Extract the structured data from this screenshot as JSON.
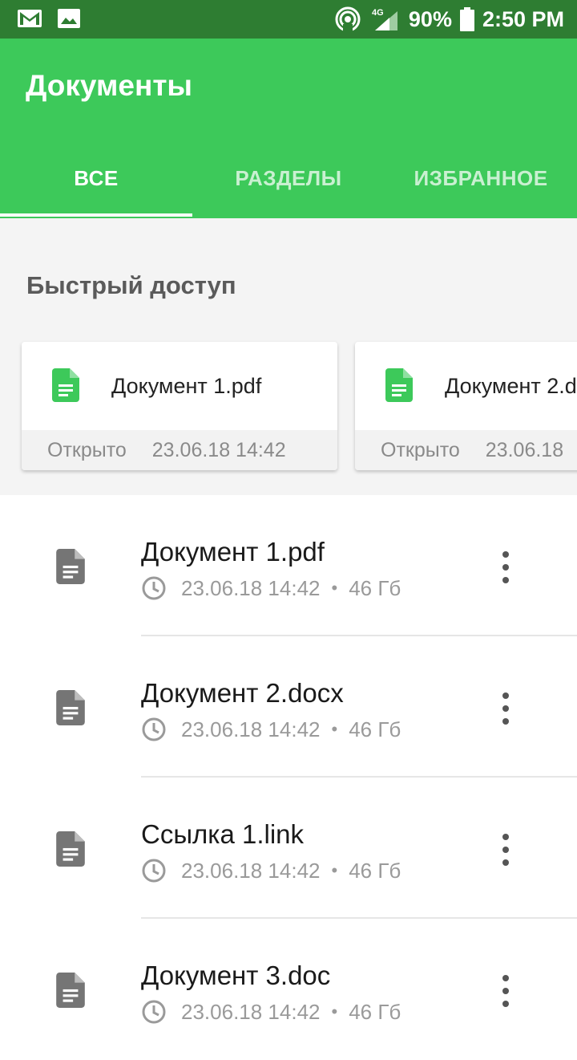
{
  "status_bar": {
    "left_icons": [
      "gmail-icon",
      "image-icon"
    ],
    "network": "4G",
    "battery": "90%",
    "time": "2:50 PM"
  },
  "app": {
    "title": "Документы",
    "accent_color": "#3dc95a",
    "status_bar_color": "#2e7d32"
  },
  "tabs": [
    {
      "label": "ВСЕ",
      "active": true
    },
    {
      "label": "РАЗДЕЛЫ",
      "active": false
    },
    {
      "label": "ИЗБРАННОЕ",
      "active": false
    }
  ],
  "quick_access": {
    "title": "Быстрый доступ",
    "cards": [
      {
        "name": "Документ 1.pdf",
        "status": "Открыто",
        "date": "23.06.18 14:42",
        "icon": "document-icon"
      },
      {
        "name": "Документ 2.d",
        "status": "Открыто",
        "date": "23.06.18",
        "icon": "document-icon"
      }
    ]
  },
  "files": [
    {
      "name": "Документ 1.pdf",
      "date": "23.06.18 14:42",
      "size": "46 Гб"
    },
    {
      "name": "Документ 2.docx",
      "date": "23.06.18 14:42",
      "size": "46 Гб"
    },
    {
      "name": "Ссылка 1.link",
      "date": "23.06.18 14:42",
      "size": "46 Гб"
    },
    {
      "name": "Документ 3.doc",
      "date": "23.06.18 14:42",
      "size": "46 Гб"
    }
  ],
  "meta_separator": "•"
}
